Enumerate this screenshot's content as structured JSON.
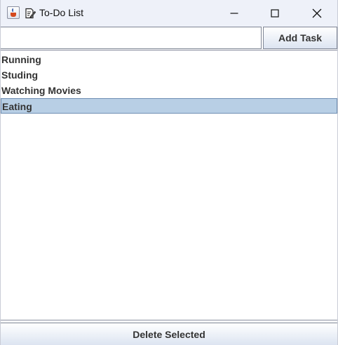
{
  "window": {
    "title": "To-Do List",
    "app_icon": "java-cup-icon",
    "title_icon": "note-pencil-icon",
    "controls": [
      "minimize-icon",
      "maximize-icon",
      "close-icon"
    ]
  },
  "input": {
    "value": "",
    "placeholder": ""
  },
  "toolbar": {
    "add_label": "Add Task"
  },
  "tasks": [
    {
      "label": "Running",
      "selected": false
    },
    {
      "label": "Studing",
      "selected": false
    },
    {
      "label": "Watching Movies",
      "selected": false
    },
    {
      "label": "Eating",
      "selected": true
    }
  ],
  "footer": {
    "delete_label": "Delete Selected"
  },
  "colors": {
    "titlebar": "#eef1f9",
    "selection": "#b8cfe5",
    "selection_border": "#6f8fb3"
  }
}
